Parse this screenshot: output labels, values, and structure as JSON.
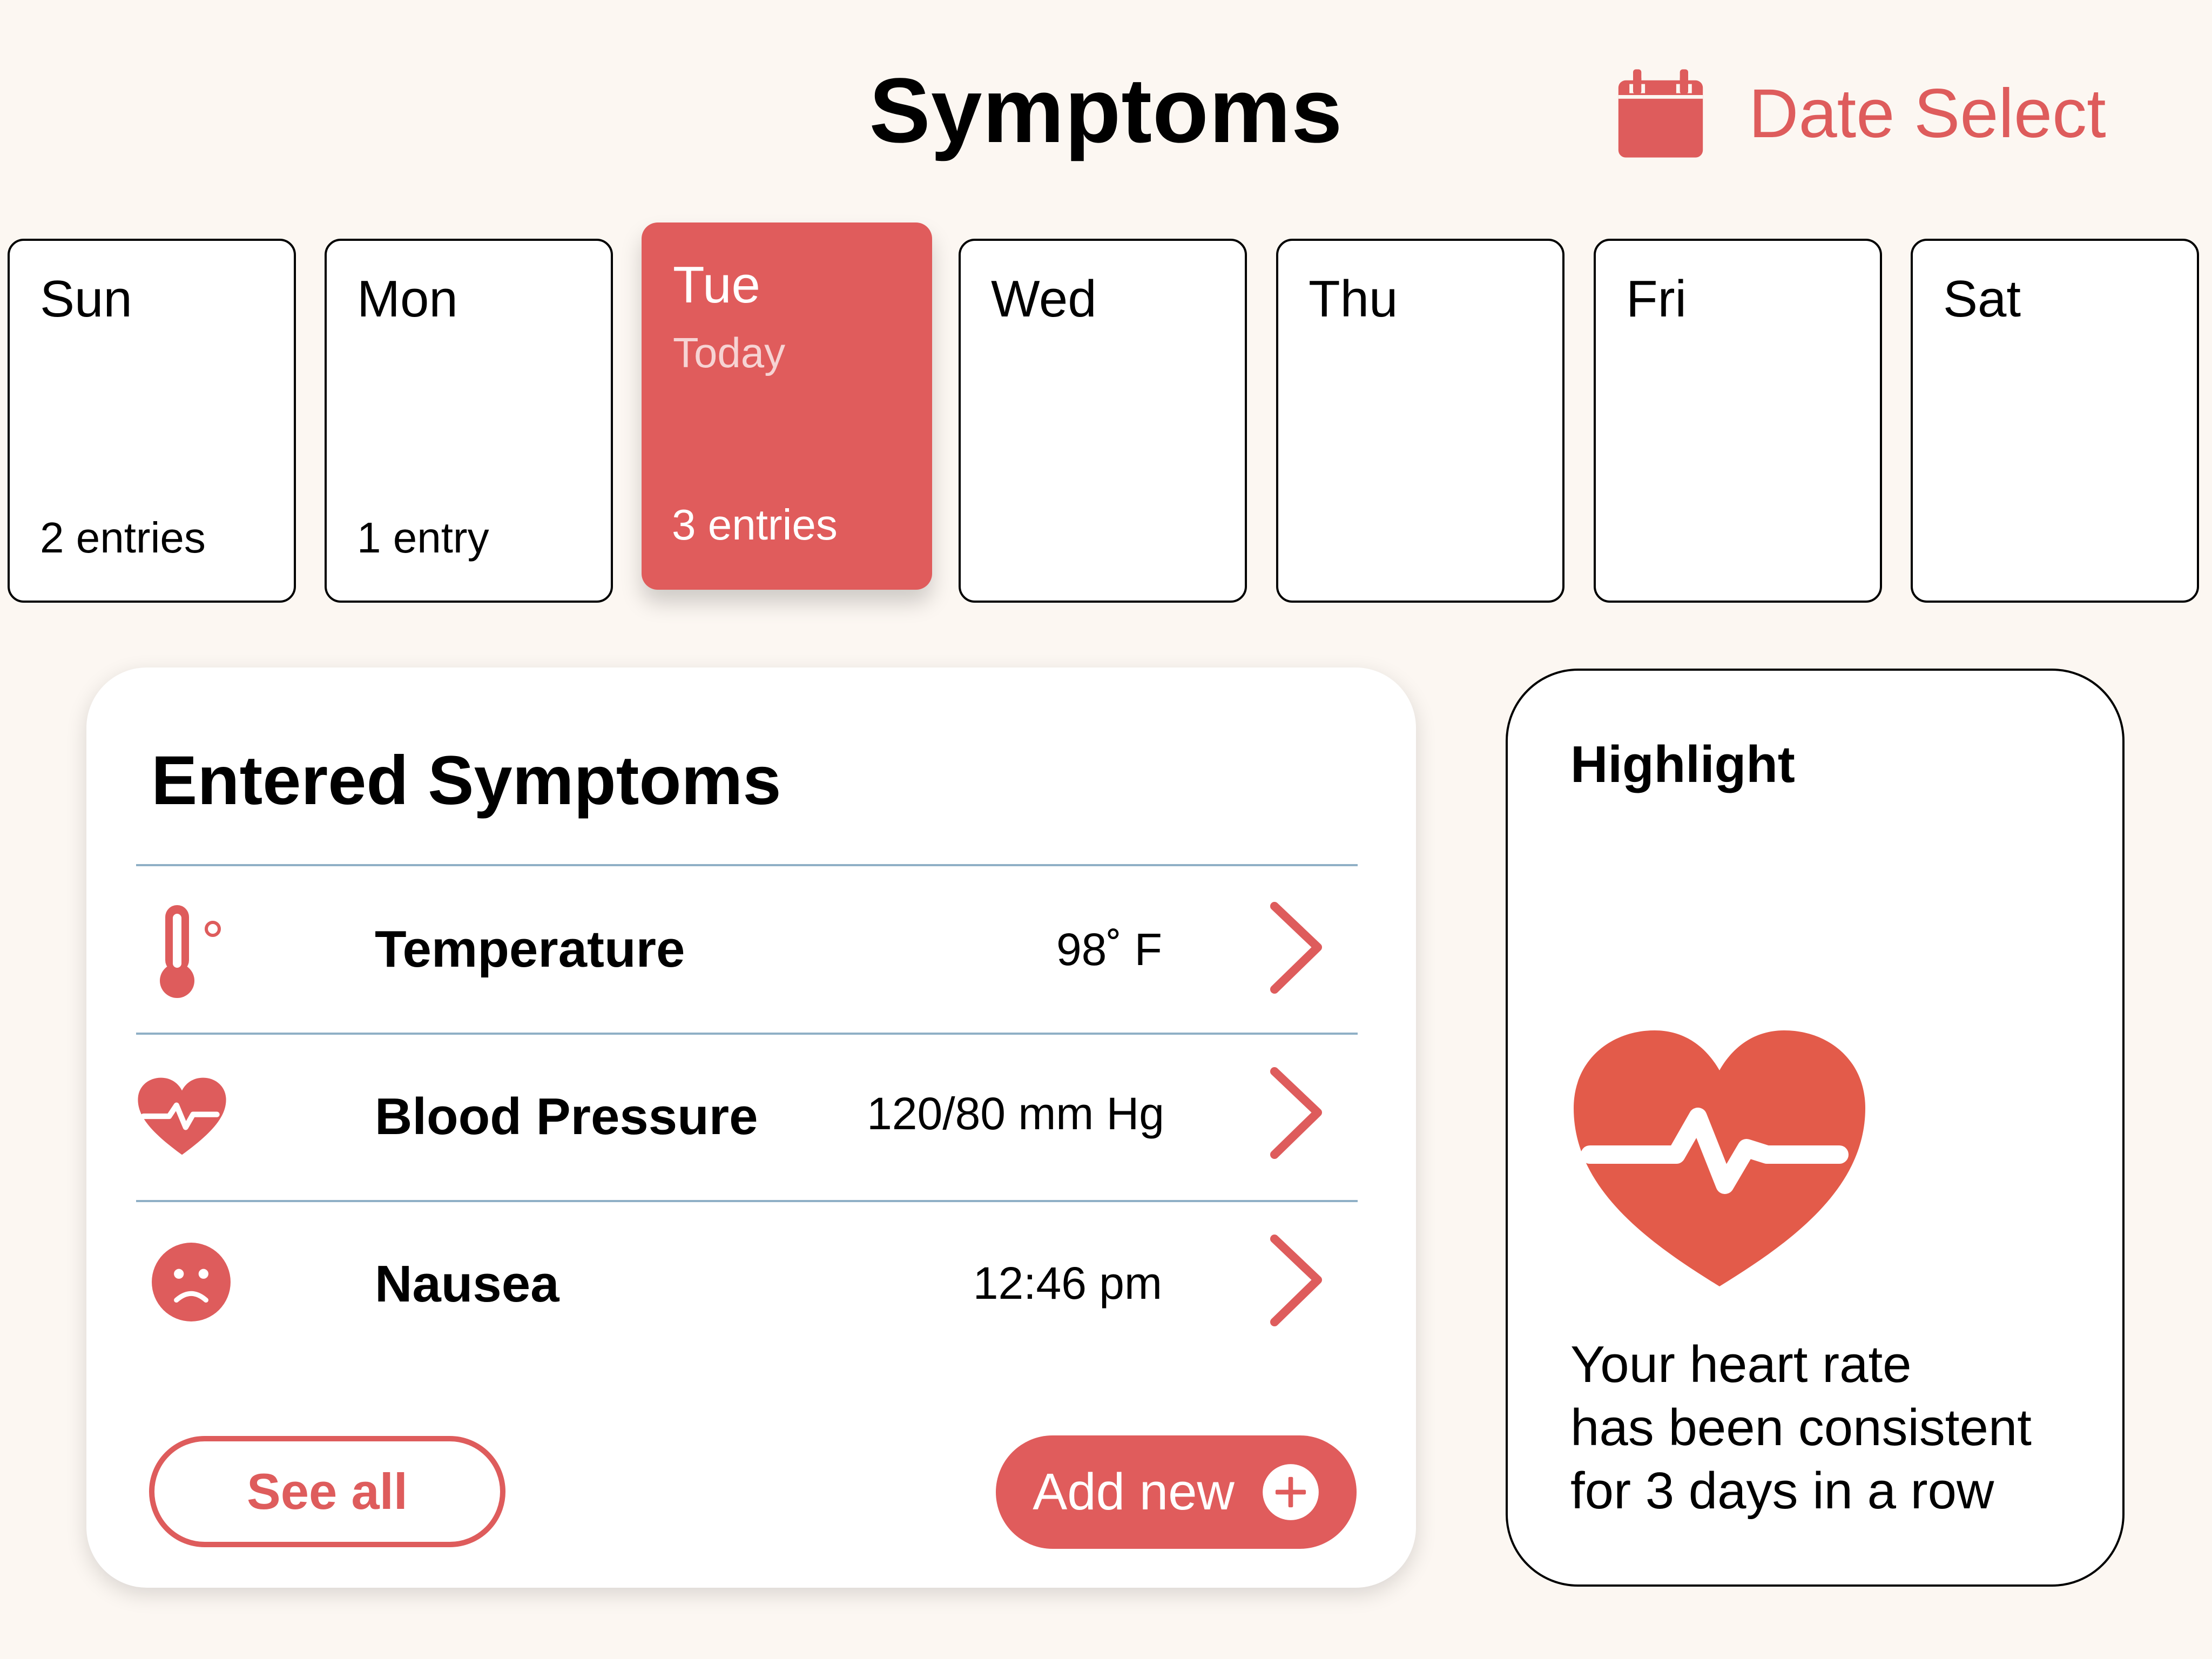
{
  "header": {
    "title": "Symptoms",
    "date_select_label": "Date Select",
    "date_select_icon": "calendar-icon"
  },
  "week": {
    "days": [
      {
        "name": "Sun",
        "entries": "2 entries"
      },
      {
        "name": "Mon",
        "entries": "1 entry"
      },
      {
        "name": "Tue",
        "subtitle": "Today",
        "entries": "3 entries",
        "selected": true
      },
      {
        "name": "Wed",
        "entries": ""
      },
      {
        "name": "Thu",
        "entries": ""
      },
      {
        "name": "Fri",
        "entries": ""
      },
      {
        "name": "Sat",
        "entries": ""
      }
    ]
  },
  "entered": {
    "heading": "Entered Symptoms",
    "items": [
      {
        "label": "Temperature",
        "value": "98˚ F",
        "icon": "thermometer-icon"
      },
      {
        "label": "Blood Pressure",
        "value": "120/80 mm Hg",
        "icon": "heart-pulse-icon"
      },
      {
        "label": "Nausea",
        "value": "12:46 pm",
        "icon": "sad-face-icon"
      }
    ],
    "see_all_label": "See all",
    "add_new_label": "Add new"
  },
  "highlight": {
    "title": "Highlight",
    "lines": [
      "Your heart rate",
      "has been consistent",
      "for 3 days in a row"
    ],
    "icon": "heart-rate-icon"
  },
  "colors": {
    "accent": "#e05c5c",
    "background": "#fcf7f2",
    "divider": "#8fb0c6",
    "heart": "#e35b4a"
  }
}
